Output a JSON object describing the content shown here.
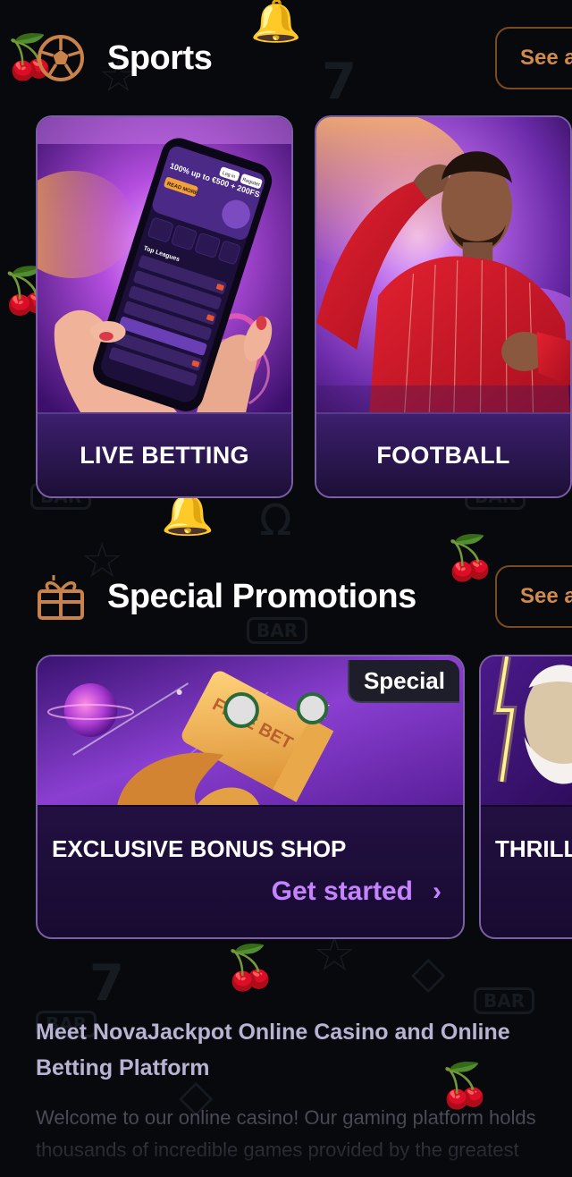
{
  "sports": {
    "title": "Sports",
    "see_all": "See all",
    "icon": "soccer-ball-icon",
    "cards": [
      {
        "label": "LIVE BETTING"
      },
      {
        "label": "FOOTBALL"
      }
    ]
  },
  "promotions": {
    "title": "Special Promotions",
    "see_all": "See all",
    "icon": "gift-icon",
    "cards": [
      {
        "badge": "Special",
        "title": "EXCLUSIVE BONUS SHOP",
        "cta": "Get started",
        "art_text": "FREE BET"
      },
      {
        "title": "THRILL"
      }
    ]
  },
  "about": {
    "title": "Meet NovaJackpot Online Casino and Online Betting Platform",
    "lines": [
      "Welcome to our online casino! Our gaming platform holds",
      "thousands of incredible games provided by the greatest"
    ]
  },
  "phone_screen": {
    "headline": "100% up to €500 + 200FS",
    "login": "Log in",
    "register": "Register",
    "cta": "READ MORE",
    "leagues_title": "Top Leagues"
  },
  "colors": {
    "background": "#07090c",
    "accent_orange": "#d28a4c",
    "accent_purple": "#c583ff",
    "card_border": "#7c5fa6"
  }
}
